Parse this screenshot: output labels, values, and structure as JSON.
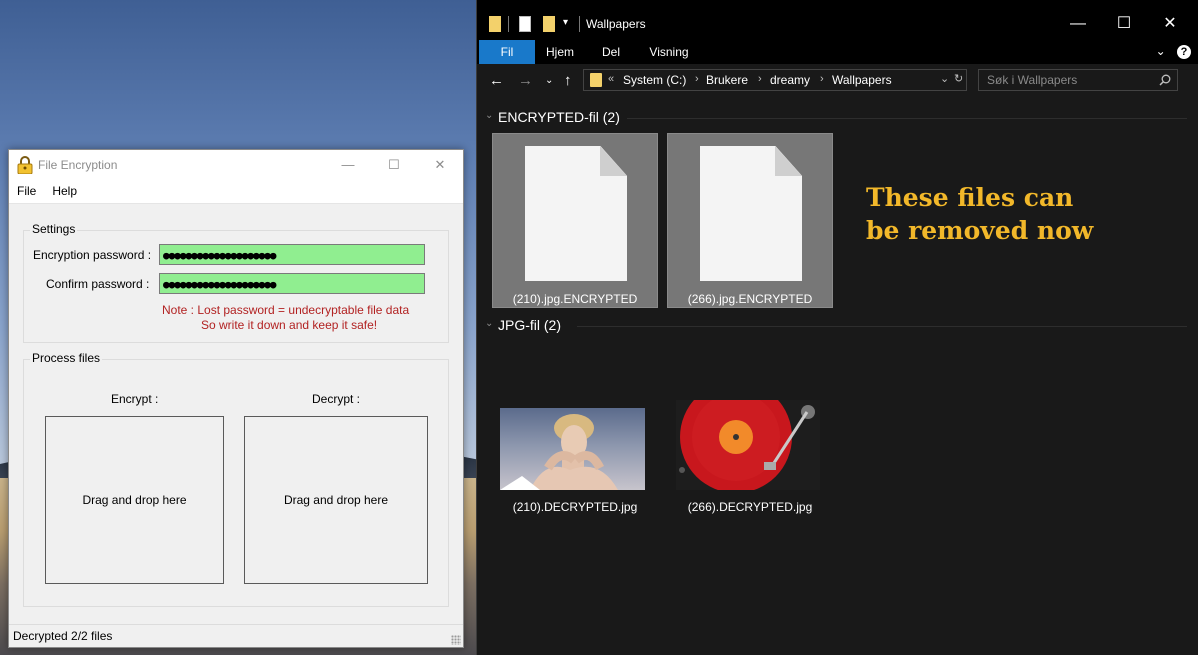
{
  "fe": {
    "title": "File Encryption",
    "menu": [
      "File",
      "Help"
    ],
    "settings_title": "Settings",
    "enc_label": "Encryption password :",
    "conf_label": "Confirm password :",
    "enc_value": "●●●●●●●●●●●●●●●●●●●●",
    "conf_value": "●●●●●●●●●●●●●●●●●●●●",
    "note_line1": "Note :  Lost password = undecryptable file data",
    "note_line2": "So write it down and keep it safe!",
    "process_title": "Process files",
    "encrypt_label": "Encrypt :",
    "decrypt_label": "Decrypt :",
    "drop_text": "Drag and drop here",
    "status": "Decrypted 2/2 files",
    "field_color": "#90ee90",
    "note_color": "#b22222"
  },
  "ex": {
    "title": "Wallpapers",
    "tabs": [
      "Fil",
      "Hjem",
      "Del",
      "Visning"
    ],
    "active_tab": "Fil",
    "breadcrumb": [
      "System (C:)",
      "Brukere",
      "dreamy",
      "Wallpapers"
    ],
    "crumb_prefix": "«",
    "search_placeholder": "Søk i Wallpapers",
    "group1": "ENCRYPTED-fil (2)",
    "group2": "JPG-fil (2)",
    "enc_files": [
      "(210).jpg.ENCRYPTED",
      "(266).jpg.ENCRYPTED"
    ],
    "jpg_files": [
      "(210).DECRYPTED.jpg",
      "(266).DECRYPTED.jpg"
    ],
    "accent_color": "#1979ca"
  },
  "overlay": {
    "line1": "These files can",
    "line2": "be removed now",
    "color": "#f2b82a"
  }
}
